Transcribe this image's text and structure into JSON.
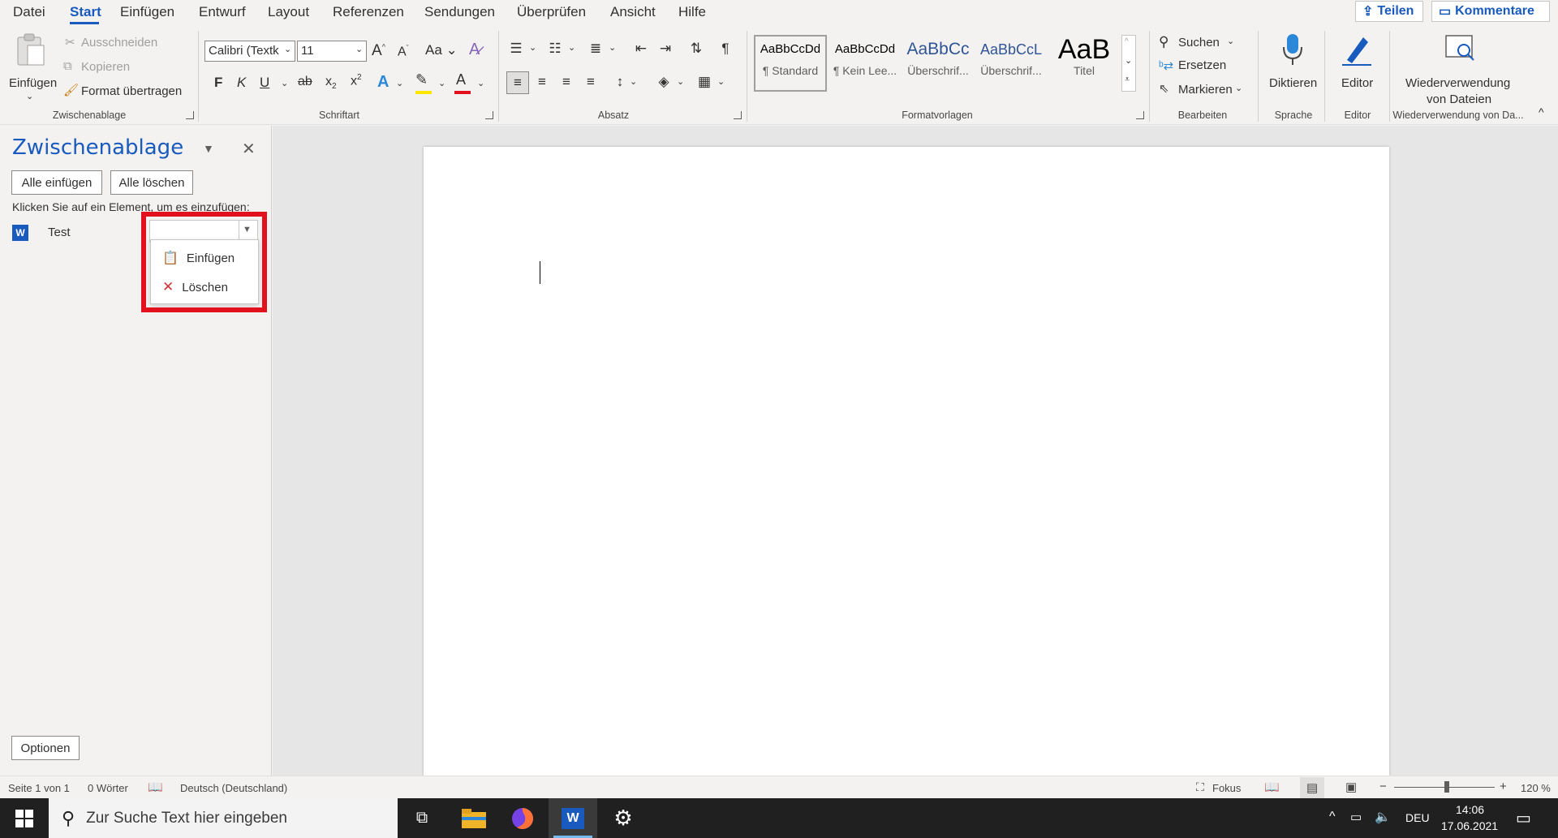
{
  "menu": {
    "tabs": [
      "Datei",
      "Start",
      "Einfügen",
      "Entwurf",
      "Layout",
      "Referenzen",
      "Sendungen",
      "Überprüfen",
      "Ansicht",
      "Hilfe"
    ],
    "active_tab": "Start",
    "share_label": "Teilen",
    "comments_label": "Kommentare"
  },
  "ribbon": {
    "clipboard": {
      "paste_label": "Einfügen",
      "cut_label": "Ausschneiden",
      "copy_label": "Kopieren",
      "format_painter_label": "Format übertragen",
      "group_label": "Zwischenablage"
    },
    "font": {
      "font_name": "Calibri (Textk",
      "font_size": "11",
      "group_label": "Schriftart",
      "bold": "F",
      "italic": "K",
      "underline": "U",
      "strike": "ab",
      "case": "Aa",
      "grow": "A",
      "shrink": "A"
    },
    "paragraph": {
      "group_label": "Absatz"
    },
    "styles": {
      "group_label": "Formatvorlagen",
      "items": [
        {
          "preview": "AaBbCcDd",
          "name": "¶ Standard"
        },
        {
          "preview": "AaBbCcDd",
          "name": "¶ Kein Lee..."
        },
        {
          "preview": "AaBbCc",
          "name": "Überschrif..."
        },
        {
          "preview": "AaBbCcL",
          "name": "Überschrif..."
        },
        {
          "preview": "AaB",
          "name": "Titel"
        }
      ]
    },
    "editing": {
      "group_label": "Bearbeiten",
      "find_label": "Suchen",
      "replace_label": "Ersetzen",
      "select_label": "Markieren"
    },
    "voice": {
      "dictate_label": "Diktieren",
      "group_label": "Sprache"
    },
    "editor": {
      "label": "Editor",
      "group_label": "Editor"
    },
    "reuse": {
      "label_line1": "Wiederverwendung",
      "label_line2": "von Dateien",
      "group_label": "Wiederverwendung von Da..."
    }
  },
  "clipboard_pane": {
    "title": "Zwischenablage",
    "paste_all": "Alle einfügen",
    "clear_all": "Alle löschen",
    "hint": "Klicken Sie auf ein Element, um es einzufügen:",
    "item_label": "Test",
    "context_menu": {
      "paste": "Einfügen",
      "delete": "Löschen"
    },
    "options": "Optionen"
  },
  "status": {
    "page": "Seite 1 von 1",
    "words": "0 Wörter",
    "language": "Deutsch (Deutschland)",
    "focus": "Fokus",
    "zoom": "120 %",
    "zoom_minus": "−",
    "zoom_plus": "+"
  },
  "taskbar": {
    "search_placeholder": "Zur Suche Text hier eingeben",
    "lang": "DEU",
    "time": "14:06",
    "date": "17.06.2021"
  },
  "colors": {
    "accent": "#185abd",
    "annotation_red": "#e3101e",
    "taskbar": "#202020"
  }
}
